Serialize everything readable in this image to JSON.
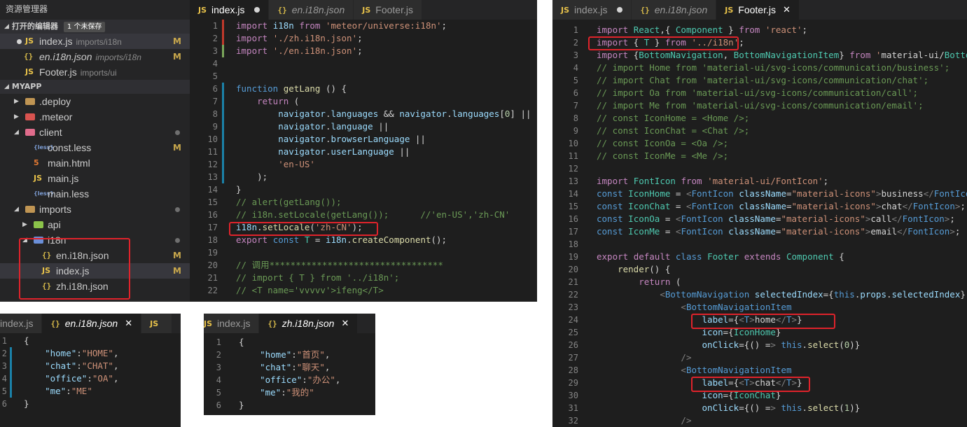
{
  "explorer": {
    "title": "资源管理器",
    "open_editors": {
      "label": "打开的编辑器",
      "badge": "1 个未保存",
      "items": [
        {
          "name": "index.js",
          "path": "imports/i18n",
          "status": "M"
        },
        {
          "name": "en.i18n.json",
          "path": "imports/i18n",
          "status": "M"
        },
        {
          "name": "Footer.js",
          "path": "imports/ui",
          "status": ""
        }
      ]
    },
    "project": {
      "label": "MYAPP",
      "items": [
        {
          "name": ".deploy",
          "status": ""
        },
        {
          "name": ".meteor",
          "status": ""
        },
        {
          "name": "client",
          "status": "dot"
        },
        {
          "name": "const.less",
          "status": "M"
        },
        {
          "name": "main.html",
          "status": ""
        },
        {
          "name": "main.js",
          "status": ""
        },
        {
          "name": "main.less",
          "status": ""
        },
        {
          "name": "imports",
          "status": "dot"
        },
        {
          "name": "api",
          "status": ""
        },
        {
          "name": "i18n",
          "status": "dot"
        },
        {
          "name": "en.i18n.json",
          "status": "M"
        },
        {
          "name": "index.js",
          "status": "M"
        },
        {
          "name": "zh.i18n.json",
          "status": ""
        }
      ]
    }
  },
  "editor_index": {
    "tabs": [
      "index.js",
      "en.i18n.json",
      "Footer.js"
    ],
    "lines": [
      "import i18n from 'meteor/universe:i18n';",
      "import './zh.i18n.json';",
      "import './en.i18n.json';",
      "",
      "",
      "function getLang () {",
      "    return (",
      "        navigator.languages && navigator.languages[0] ||",
      "        navigator.language ||",
      "        navigator.browserLanguage ||",
      "        navigator.userLanguage ||",
      "        'en-US'",
      "    );",
      "}",
      "// alert(getLang());",
      "// i18n.setLocale(getLang());      //'en-US','zh-CN'",
      "i18n.setLocale('zh-CN');",
      "export const T = i18n.createComponent();",
      "",
      "// 调用*********************************",
      "// import { T } from '../i18n';",
      "// <T name='vvvvv'>ifeng</T>"
    ]
  },
  "editor_footer": {
    "tabs": [
      "index.js",
      "en.i18n.json",
      "Footer.js"
    ],
    "lines": [
      "import React,{ Component } from 'react';",
      "import { T } from '../i18n';",
      "import {BottomNavigation, BottomNavigationItem} from 'material-ui/BottomNa",
      "// import Home from 'material-ui/svg-icons/communication/business';",
      "// import Chat from 'material-ui/svg-icons/communication/chat';",
      "// import Oa from 'material-ui/svg-icons/communication/call';",
      "// import Me from 'material-ui/svg-icons/communication/email';",
      "// const IconHome = <Home />;",
      "// const IconChat = <Chat />;",
      "// const IconOa = <Oa />;",
      "// const IconMe = <Me />;",
      "",
      "import FontIcon from 'material-ui/FontIcon';",
      "const IconHome = <FontIcon className=\"material-icons\">business</FontIcon>",
      "const IconChat = <FontIcon className=\"material-icons\">chat</FontIcon>;",
      "const IconOa = <FontIcon className=\"material-icons\">call</FontIcon>;",
      "const IconMe = <FontIcon className=\"material-icons\">email</FontIcon>;",
      "",
      "export default class Footer extends Component {",
      "    render() {",
      "        return (",
      "            <BottomNavigation selectedIndex={this.props.selectedIndex} zDe",
      "                <BottomNavigationItem",
      "                    label={<T>home</T>}",
      "                    icon={IconHome}",
      "                    onClick={() => this.select(0)}",
      "                />",
      "                <BottomNavigationItem",
      "                    label={<T>chat</T>}",
      "                    icon={IconChat}",
      "                    onClick={() => this.select(1)}",
      "                />"
    ]
  },
  "editor_en": {
    "tabs": [
      "index.js",
      "en.i18n.json",
      "JS"
    ],
    "lines": [
      "{",
      "    \"home\":\"HOME\",",
      "    \"chat\":\"CHAT\",",
      "    \"office\":\"OA\",",
      "    \"me\":\"ME\"",
      "}"
    ]
  },
  "editor_zh": {
    "tabs": [
      "index.js",
      "zh.i18n.json"
    ],
    "lines": [
      "{",
      "    \"home\":\"首页\",",
      "    \"chat\":\"聊天\",",
      "    \"office\":\"办公\",",
      "    \"me\":\"我的\"",
      "}"
    ]
  },
  "colors": {
    "highlight_box": "#e0232b",
    "editor_bg": "#1e1e1e",
    "sidebar_bg": "#252526"
  }
}
